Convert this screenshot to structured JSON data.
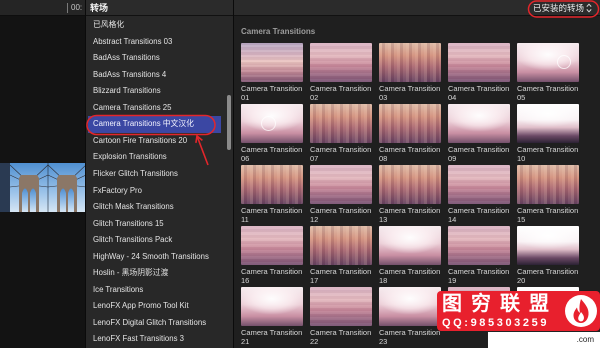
{
  "colors": {
    "selection": "#3b47a3",
    "annotation_red": "#e3262b",
    "watermark_red": "#e8202d"
  },
  "viewer": {
    "timecode": "00:"
  },
  "sidebar": {
    "title": "转场",
    "selected_index": 6,
    "items": [
      {
        "label": "已风格化"
      },
      {
        "label": "Abstract Transitions 03"
      },
      {
        "label": "BadAss Transitions"
      },
      {
        "label": "BadAss Transitions 4"
      },
      {
        "label": "Blizzard Transitions"
      },
      {
        "label": "Camera Transitions 25"
      },
      {
        "label": "Camera Transitions 中文汉化"
      },
      {
        "label": "Cartoon Fire Transitions 20"
      },
      {
        "label": "Explosion Transitions"
      },
      {
        "label": "Flicker Glitch Transitions"
      },
      {
        "label": "FxFactory Pro"
      },
      {
        "label": "Glitch Mask Transitions"
      },
      {
        "label": "Glitch Transitions 15"
      },
      {
        "label": "Glitch Transitions Pack"
      },
      {
        "label": "HighWay - 24 Smooth Transitions"
      },
      {
        "label": "Hoslin - 黑场阴影过渡"
      },
      {
        "label": "Ice Transitions"
      },
      {
        "label": "LenoFX App Promo Tool Kit"
      },
      {
        "label": "LenoFX Digital Glitch Transitions"
      },
      {
        "label": "LenoFX Fast Transitions 3"
      }
    ]
  },
  "browser": {
    "filter": {
      "label": "已安装的转场",
      "icon": "chevron-updown-icon"
    },
    "section_title": "Camera Transitions",
    "items": [
      {
        "title": "Camera Transition",
        "number": "01"
      },
      {
        "title": "Camera Transition",
        "number": "02"
      },
      {
        "title": "Camera Transition",
        "number": "03"
      },
      {
        "title": "Camera Transition",
        "number": "04"
      },
      {
        "title": "Camera Transition",
        "number": "05"
      },
      {
        "title": "Camera Transition",
        "number": "06"
      },
      {
        "title": "Camera Transition",
        "number": "07"
      },
      {
        "title": "Camera Transition",
        "number": "08"
      },
      {
        "title": "Camera Transition",
        "number": "09"
      },
      {
        "title": "Camera Transition",
        "number": "10"
      },
      {
        "title": "Camera Transition",
        "number": "11"
      },
      {
        "title": "Camera Transition",
        "number": "12"
      },
      {
        "title": "Camera Transition",
        "number": "13"
      },
      {
        "title": "Camera Transition",
        "number": "14"
      },
      {
        "title": "Camera Transition",
        "number": "15"
      },
      {
        "title": "Camera Transition",
        "number": "16"
      },
      {
        "title": "Camera Transition",
        "number": "17"
      },
      {
        "title": "Camera Transition",
        "number": "18"
      },
      {
        "title": "Camera Transition",
        "number": "19"
      },
      {
        "title": "Camera Transition",
        "number": "20"
      },
      {
        "title": "Camera Transition",
        "number": "21"
      },
      {
        "title": "Camera Transition",
        "number": "22"
      },
      {
        "title": "Camera Transition",
        "number": "23"
      },
      {},
      {}
    ]
  },
  "watermark": {
    "name": "图穷联盟",
    "qq": "QQ:985303259",
    "logo_icon": "flame-logo-icon",
    "site": ".com"
  },
  "annotations": {
    "arrow_icon": "red-arrow-icon"
  }
}
